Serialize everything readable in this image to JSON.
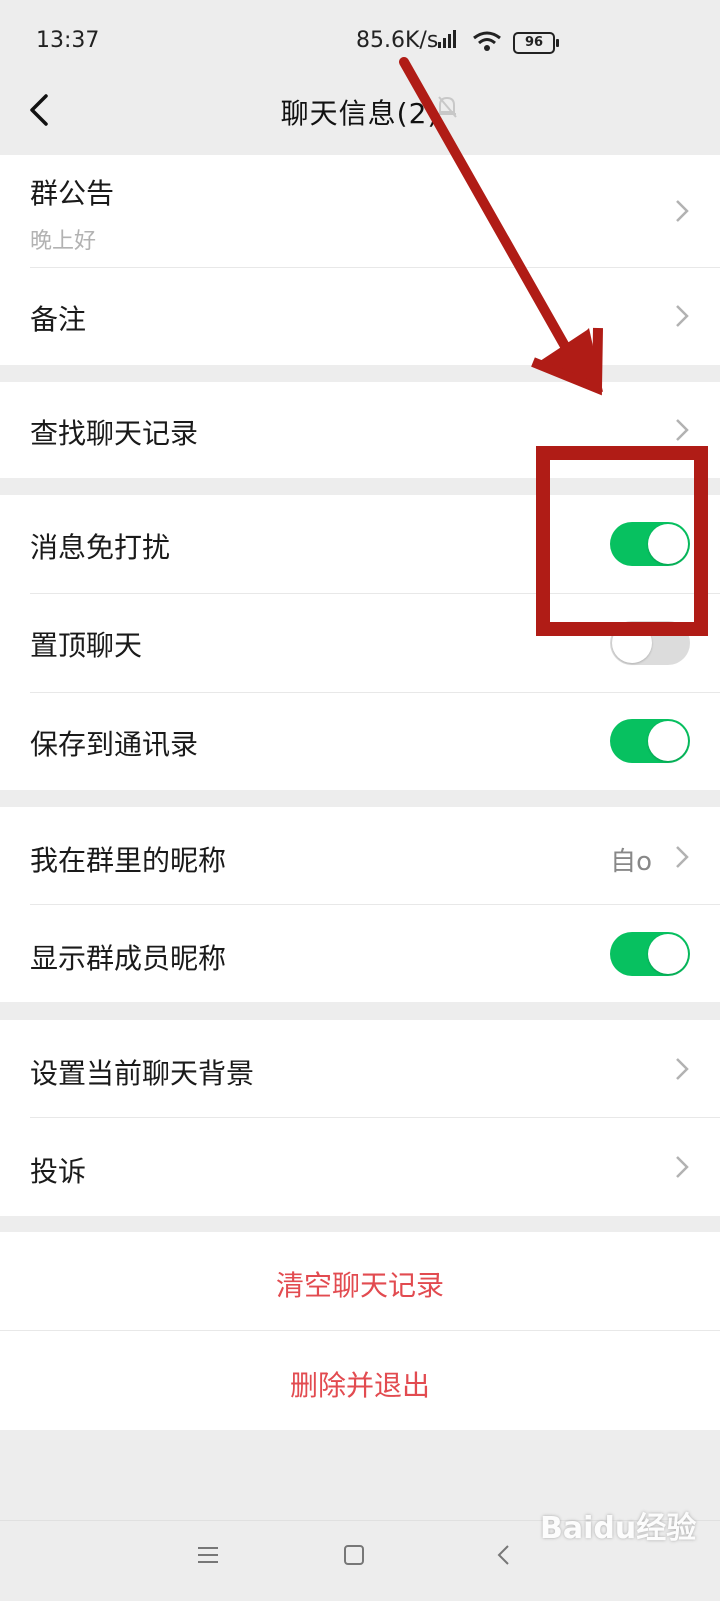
{
  "status": {
    "time": "13:37",
    "net_speed": "85.6K/s",
    "battery": "96"
  },
  "nav": {
    "title": "聊天信息(2)"
  },
  "announcement": {
    "label": "群公告",
    "text": "晚上好"
  },
  "remark": {
    "label": "备注"
  },
  "search_history": {
    "label": "查找聊天记录"
  },
  "toggles": {
    "mute": {
      "label": "消息免打扰",
      "on": true
    },
    "pin": {
      "label": "置顶聊天",
      "on": false
    },
    "save_contacts": {
      "label": "保存到通讯录",
      "on": true
    }
  },
  "nickname": {
    "label": "我在群里的昵称",
    "value": "自o"
  },
  "show_nicknames": {
    "label": "显示群成员昵称",
    "on": true
  },
  "background": {
    "label": "设置当前聊天背景"
  },
  "complain": {
    "label": "投诉"
  },
  "actions": {
    "clear": "清空聊天记录",
    "exit": "删除并退出"
  },
  "colors": {
    "accent_green": "#07c160",
    "danger_red": "#e24b50",
    "annotation_red": "#b01c16"
  },
  "watermark": "Baidu经验"
}
